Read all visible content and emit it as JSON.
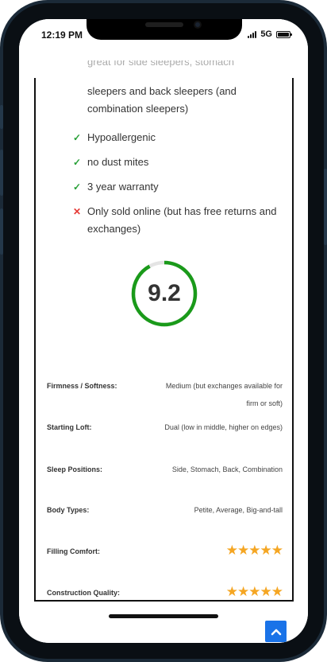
{
  "status": {
    "time": "12:19 PM",
    "network": "5G"
  },
  "article": {
    "cut_off_line": "great for side sleepers, stomach",
    "continued_text": "sleepers and back sleepers (and combination sleepers)",
    "pros_cons": [
      {
        "type": "pro",
        "text": "Hypoallergenic"
      },
      {
        "type": "pro",
        "text": "no dust mites"
      },
      {
        "type": "pro",
        "text": "3 year warranty"
      },
      {
        "type": "con",
        "text": "Only sold online (but has free returns and exchanges)"
      }
    ],
    "score": {
      "value": "9.2",
      "fraction": 0.92,
      "ring_color": "#1a9a1a"
    },
    "specs": [
      {
        "label": "Firmness / Softness:",
        "value": "Medium (but exchanges available for firm or soft)"
      },
      {
        "label": "Starting Loft:",
        "value": "Dual (low in middle, higher on edges)"
      },
      {
        "label": "Sleep Positions:",
        "value": "Side, Stomach, Back, Combination"
      },
      {
        "label": "Body Types:",
        "value": "Petite, Average, Big-and-tall"
      },
      {
        "label": "Filling Comfort:",
        "stars": 5
      },
      {
        "label": "Construction Quality:",
        "stars": 5
      }
    ]
  },
  "icons": {
    "pro": "✓",
    "con": "✕",
    "star": "★",
    "scroll_top": "chevron-up-icon"
  },
  "colors": {
    "check": "#27a037",
    "cross": "#e53935",
    "star": "#f5a623",
    "scroll_button": "#1a73e8"
  }
}
